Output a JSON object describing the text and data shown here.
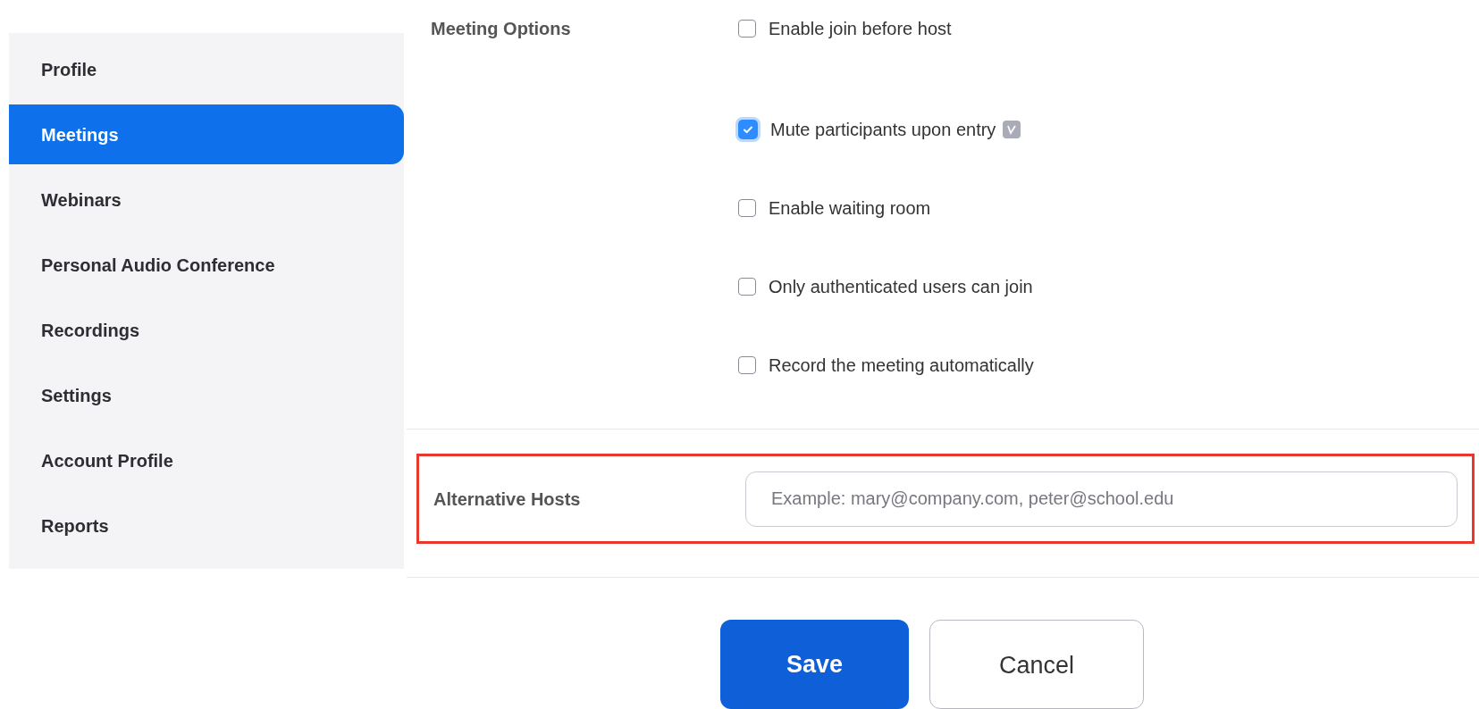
{
  "sidebar": {
    "items": [
      {
        "label": "Profile",
        "selected": false
      },
      {
        "label": "Meetings",
        "selected": true
      },
      {
        "label": "Webinars",
        "selected": false
      },
      {
        "label": "Personal Audio Conference",
        "selected": false
      },
      {
        "label": "Recordings",
        "selected": false
      },
      {
        "label": "Settings",
        "selected": false
      },
      {
        "label": "Account Profile",
        "selected": false
      },
      {
        "label": "Reports",
        "selected": false
      }
    ]
  },
  "meeting_options": {
    "label": "Meeting Options",
    "options": [
      {
        "label": "Enable join before host",
        "checked": false,
        "badge": false
      },
      {
        "label": "Mute participants upon entry",
        "checked": true,
        "badge": true
      },
      {
        "label": "Enable waiting room",
        "checked": false,
        "badge": false
      },
      {
        "label": "Only authenticated users can join",
        "checked": false,
        "badge": false
      },
      {
        "label": "Record the meeting automatically",
        "checked": false,
        "badge": false
      }
    ]
  },
  "alternative_hosts": {
    "label": "Alternative Hosts",
    "placeholder": "Example: mary@company.com, peter@school.edu",
    "highlighted": true
  },
  "buttons": [
    {
      "label": "Save",
      "kind": "primary"
    },
    {
      "label": "Cancel",
      "kind": "secondary"
    }
  ]
}
